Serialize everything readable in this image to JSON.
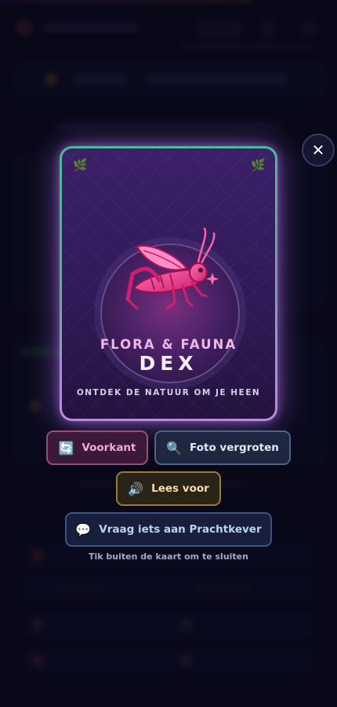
{
  "card": {
    "title_top": "FLORA & FAUNA",
    "title_main": "DEX",
    "tagline": "ONTDEK DE NATUUR OM JE HEEN",
    "leaf_glyph": "🌿",
    "illustration": "grasshopper",
    "border_colors": [
      "#4fb89a",
      "#b98be0"
    ]
  },
  "close": {
    "label": "✕"
  },
  "buttons": {
    "front": {
      "icon": "🔄",
      "label": "Voorkant"
    },
    "photo": {
      "icon": "🔍",
      "label": "Foto vergroten"
    },
    "read": {
      "icon": "🔊",
      "label": "Lees voor"
    },
    "ask": {
      "icon": "💬",
      "label": "Vraag iets aan Prachtkever"
    }
  },
  "hint": "Tik buiten de kaart om te sluiten"
}
